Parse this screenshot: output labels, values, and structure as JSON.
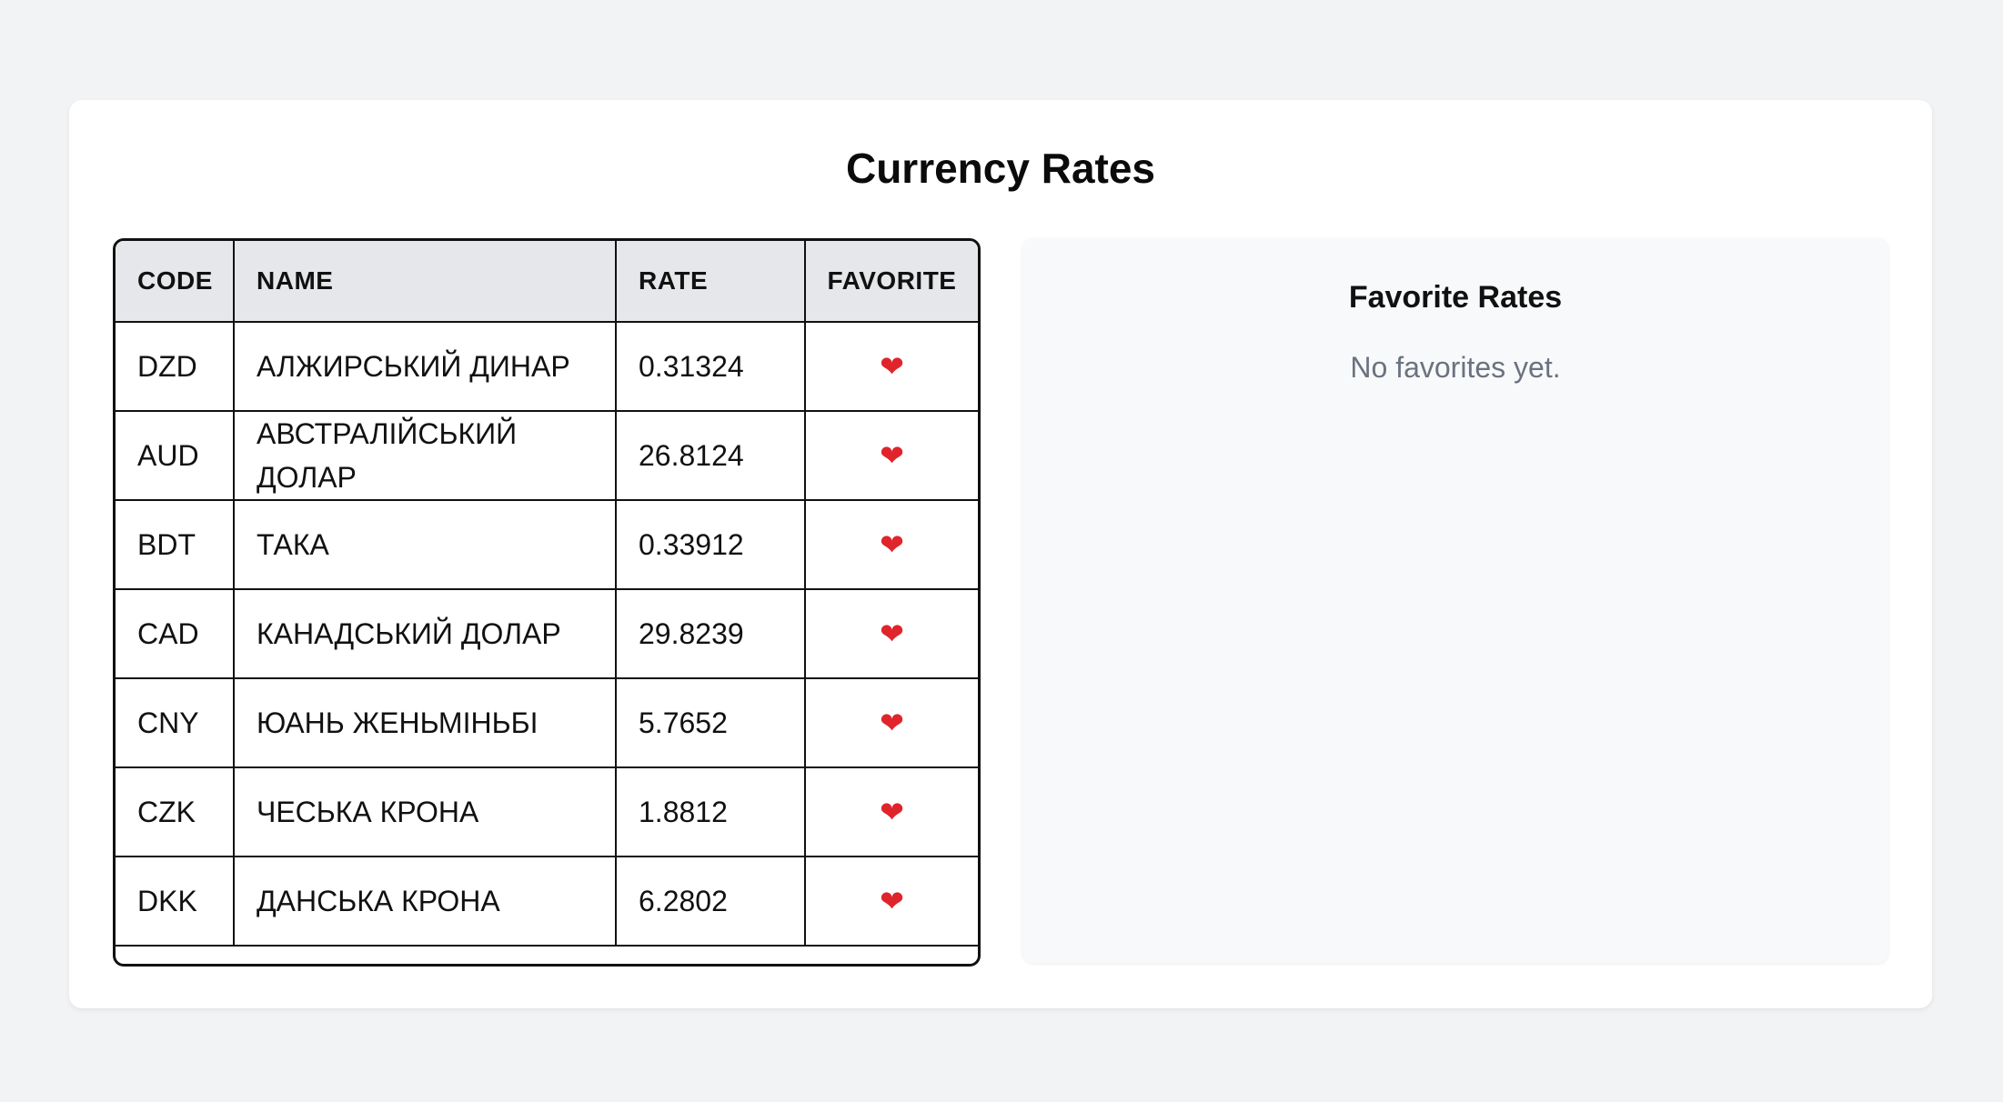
{
  "page": {
    "title": "Currency Rates"
  },
  "table": {
    "headers": {
      "code": "CODE",
      "name": "NAME",
      "rate": "RATE",
      "favorite": "FAVORITE"
    },
    "favorite_icon": "heart-icon",
    "favorite_glyph": "❤",
    "rows": [
      {
        "code": "DZD",
        "name": "АЛЖИРСЬКИЙ ДИНАР",
        "rate": "0.31324"
      },
      {
        "code": "AUD",
        "name": "АВСТРАЛІЙСЬКИЙ ДОЛАР",
        "rate": "26.8124"
      },
      {
        "code": "BDT",
        "name": "ТАКА",
        "rate": "0.33912"
      },
      {
        "code": "CAD",
        "name": "КАНАДСЬКИЙ ДОЛАР",
        "rate": "29.8239"
      },
      {
        "code": "CNY",
        "name": "ЮАНЬ ЖЕНЬМІНЬБІ",
        "rate": "5.7652"
      },
      {
        "code": "CZK",
        "name": "ЧЕСЬКА КРОНА",
        "rate": "1.8812"
      },
      {
        "code": "DKK",
        "name": "ДАНСЬКА КРОНА",
        "rate": "6.2802"
      }
    ]
  },
  "favorites": {
    "title": "Favorite Rates",
    "empty_text": "No favorites yet."
  },
  "colors": {
    "background": "#f2f3f5",
    "card": "#ffffff",
    "header_bg": "#e5e7eb",
    "heart": "#e0242b",
    "muted_text": "#6b7280"
  }
}
